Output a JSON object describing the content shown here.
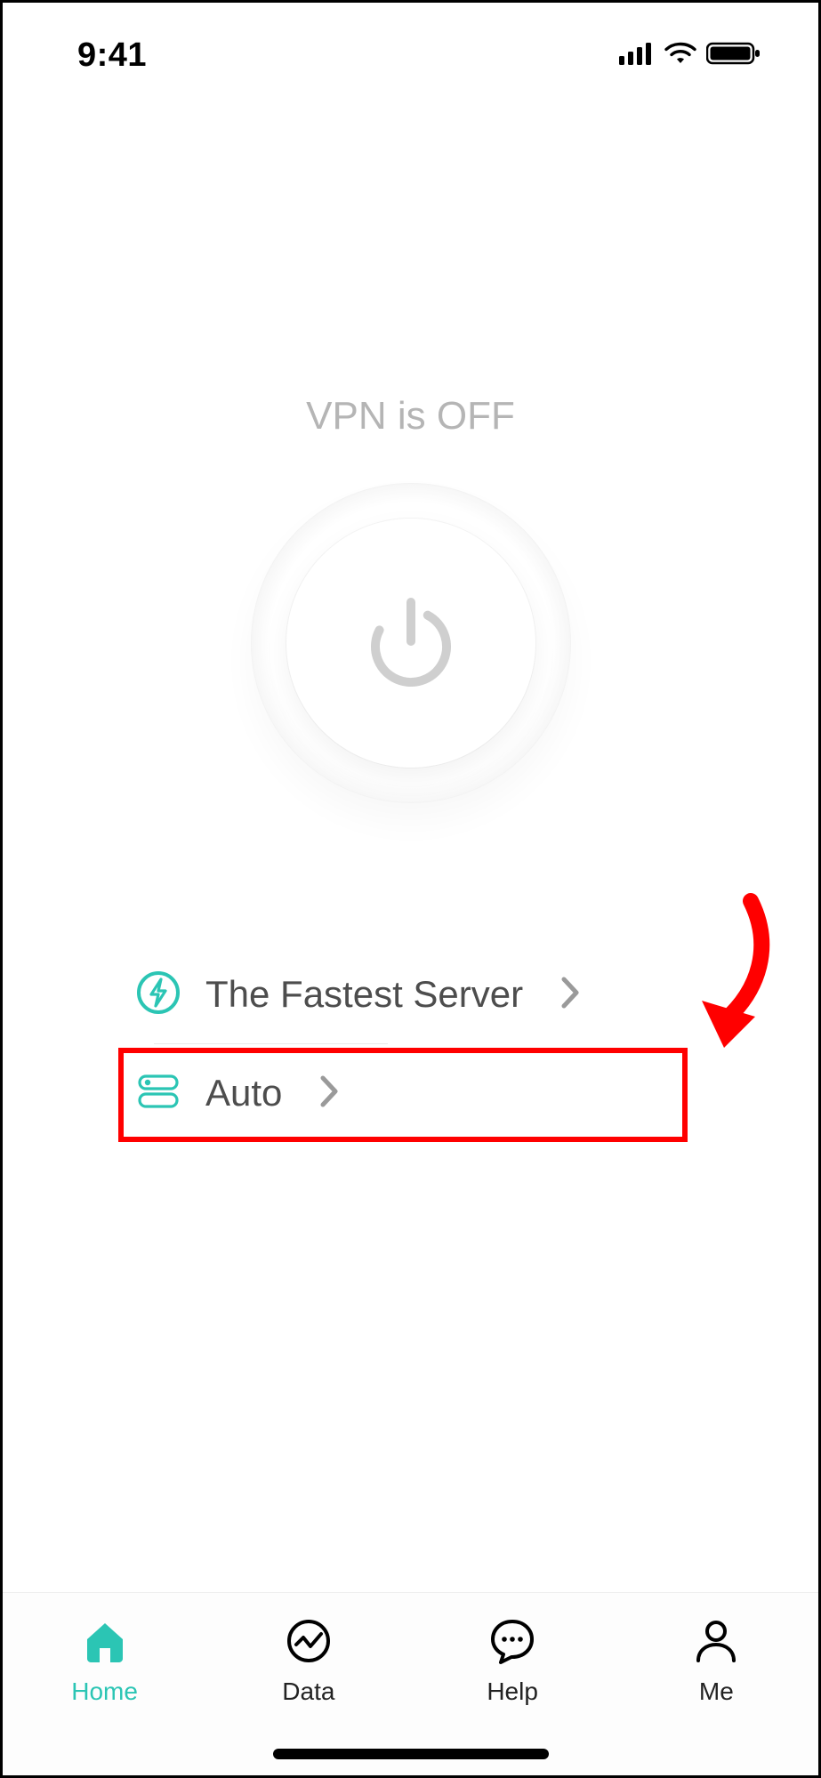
{
  "statusbar": {
    "time": "9:41"
  },
  "vpn": {
    "status_text": "VPN is OFF"
  },
  "options": {
    "server_label": "The Fastest Server",
    "protocol_label": "Auto"
  },
  "tabs": {
    "home": "Home",
    "data": "Data",
    "help": "Help",
    "me": "Me"
  },
  "colors": {
    "accent": "#2bc5b4",
    "highlight": "#ff0000"
  }
}
